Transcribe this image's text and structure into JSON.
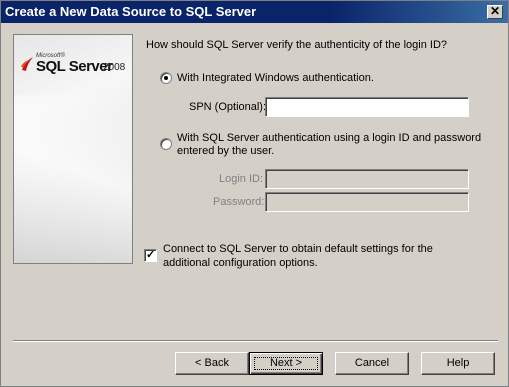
{
  "window": {
    "title": "Create a New Data Source to SQL Server",
    "close_glyph": "✕"
  },
  "logo": {
    "microsoft": "Microsoft®",
    "product": "SQL Server",
    "version": "2008"
  },
  "auth": {
    "question": "How should SQL Server verify the authenticity of the login ID?",
    "integrated_label": "With Integrated Windows authentication.",
    "spn_label": "SPN (Optional):",
    "spn_value": "",
    "sql_auth_label_line1": "With SQL Server authentication using a login ID and password",
    "sql_auth_label_line2": "entered by the user.",
    "login_id_label": "Login ID:",
    "login_id_value": "",
    "password_label": "Password:",
    "password_value": "",
    "selected": "integrated"
  },
  "connect": {
    "label_line1": "Connect to SQL Server to obtain default settings for the",
    "label_line2": "additional configuration options.",
    "checked": true
  },
  "buttons": {
    "back": "< Back",
    "next": "Next >",
    "cancel": "Cancel",
    "help": "Help"
  }
}
